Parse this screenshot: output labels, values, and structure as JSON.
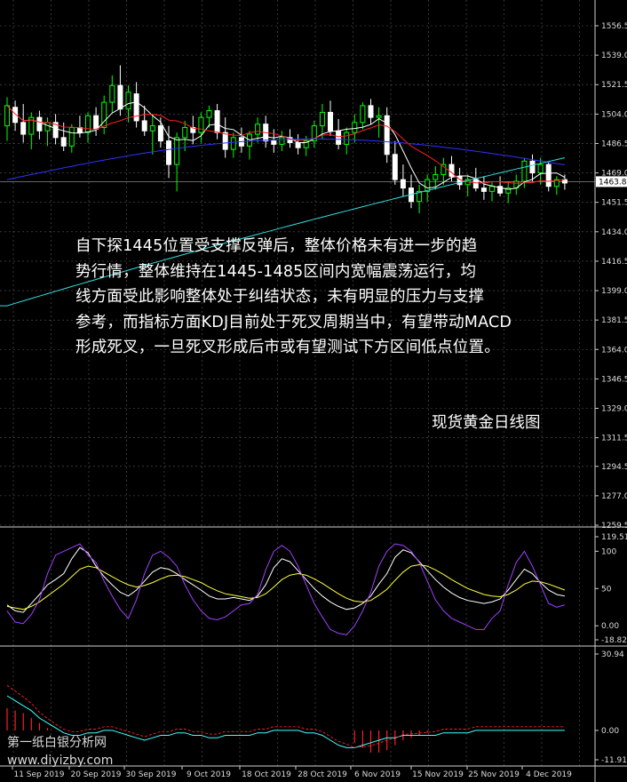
{
  "annotation": {
    "line1": "自下探1445位置受支撑反弹后，整体价格未有进一步的趋",
    "line2": "势行情，整体维持在1445-1485区间内宽幅震荡运行，均",
    "line3": "线方面受此影响整体处于纠结状态，未有明显的压力与支撑",
    "line4": "参考，而指标方面KDJ目前处于死叉周期当中，有望带动MACD",
    "line5": "形成死叉，一旦死叉形成后市或有望测试下方区间低点位置。"
  },
  "caption": "现货黄金日线图",
  "watermark": {
    "line1": "第一纸白银分析网",
    "line2": "www.diyizby.com"
  },
  "colors": {
    "background": "#000000",
    "bull_candle": "#00ff00",
    "bear_candle": "#ffffff",
    "ma_fast": "#ffffff",
    "ma_mid": "#ff2020",
    "ma_slow": "#3030ff",
    "ma_long": "#30e0e0",
    "kdj_k": "#ffffff",
    "kdj_d": "#ffff40",
    "kdj_j": "#a040ff",
    "macd_hist": "#ff2020",
    "macd_signal": "#40ffff"
  },
  "chart_data": [
    {
      "type": "candlestick",
      "panel": "price",
      "y_ticks": [
        "1556.5",
        "1539.0",
        "1521.5",
        "1504.0",
        "1486.5",
        "1469.0",
        "1451.5",
        "1434.0",
        "1416.5",
        "1399.0",
        "1381.5",
        "1364.0",
        "1346.5",
        "1329.0",
        "1311.5",
        "1294.5",
        "1277.0",
        "1259.5"
      ],
      "ylim": [
        1259.5,
        1556.5
      ],
      "current_price": "1463.8",
      "candles": [
        {
          "o": 1497,
          "h": 1514,
          "l": 1488,
          "c": 1509
        },
        {
          "o": 1508,
          "h": 1512,
          "l": 1494,
          "c": 1499
        },
        {
          "o": 1499,
          "h": 1510,
          "l": 1487,
          "c": 1492
        },
        {
          "o": 1492,
          "h": 1505,
          "l": 1483,
          "c": 1502
        },
        {
          "o": 1502,
          "h": 1506,
          "l": 1489,
          "c": 1494
        },
        {
          "o": 1494,
          "h": 1502,
          "l": 1485,
          "c": 1499
        },
        {
          "o": 1499,
          "h": 1504,
          "l": 1486,
          "c": 1490
        },
        {
          "o": 1490,
          "h": 1499,
          "l": 1482,
          "c": 1485
        },
        {
          "o": 1485,
          "h": 1498,
          "l": 1481,
          "c": 1496
        },
        {
          "o": 1496,
          "h": 1503,
          "l": 1490,
          "c": 1493
        },
        {
          "o": 1493,
          "h": 1505,
          "l": 1487,
          "c": 1503
        },
        {
          "o": 1503,
          "h": 1508,
          "l": 1491,
          "c": 1495
        },
        {
          "o": 1496,
          "h": 1515,
          "l": 1492,
          "c": 1511
        },
        {
          "o": 1511,
          "h": 1527,
          "l": 1505,
          "c": 1521
        },
        {
          "o": 1521,
          "h": 1533,
          "l": 1503,
          "c": 1507
        },
        {
          "o": 1507,
          "h": 1521,
          "l": 1499,
          "c": 1517
        },
        {
          "o": 1516,
          "h": 1523,
          "l": 1496,
          "c": 1500
        },
        {
          "o": 1500,
          "h": 1509,
          "l": 1491,
          "c": 1494
        },
        {
          "o": 1494,
          "h": 1504,
          "l": 1480,
          "c": 1497
        },
        {
          "o": 1497,
          "h": 1502,
          "l": 1484,
          "c": 1488
        },
        {
          "o": 1488,
          "h": 1497,
          "l": 1466,
          "c": 1474
        },
        {
          "o": 1474,
          "h": 1493,
          "l": 1458,
          "c": 1490
        },
        {
          "o": 1490,
          "h": 1500,
          "l": 1482,
          "c": 1496
        },
        {
          "o": 1496,
          "h": 1503,
          "l": 1486,
          "c": 1493
        },
        {
          "o": 1493,
          "h": 1505,
          "l": 1487,
          "c": 1502
        },
        {
          "o": 1502,
          "h": 1509,
          "l": 1496,
          "c": 1506
        },
        {
          "o": 1506,
          "h": 1510,
          "l": 1489,
          "c": 1493
        },
        {
          "o": 1493,
          "h": 1502,
          "l": 1478,
          "c": 1483
        },
        {
          "o": 1483,
          "h": 1493,
          "l": 1478,
          "c": 1490
        },
        {
          "o": 1490,
          "h": 1496,
          "l": 1481,
          "c": 1485
        },
        {
          "o": 1485,
          "h": 1494,
          "l": 1477,
          "c": 1492
        },
        {
          "o": 1492,
          "h": 1502,
          "l": 1487,
          "c": 1498
        },
        {
          "o": 1498,
          "h": 1503,
          "l": 1484,
          "c": 1488
        },
        {
          "o": 1488,
          "h": 1495,
          "l": 1481,
          "c": 1486
        },
        {
          "o": 1486,
          "h": 1494,
          "l": 1482,
          "c": 1490
        },
        {
          "o": 1490,
          "h": 1495,
          "l": 1484,
          "c": 1487
        },
        {
          "o": 1487,
          "h": 1492,
          "l": 1480,
          "c": 1484
        },
        {
          "o": 1484,
          "h": 1491,
          "l": 1479,
          "c": 1488
        },
        {
          "o": 1488,
          "h": 1500,
          "l": 1484,
          "c": 1497
        },
        {
          "o": 1497,
          "h": 1510,
          "l": 1489,
          "c": 1505
        },
        {
          "o": 1505,
          "h": 1512,
          "l": 1491,
          "c": 1494
        },
        {
          "o": 1494,
          "h": 1501,
          "l": 1483,
          "c": 1486
        },
        {
          "o": 1486,
          "h": 1496,
          "l": 1480,
          "c": 1493
        },
        {
          "o": 1493,
          "h": 1504,
          "l": 1487,
          "c": 1499
        },
        {
          "o": 1499,
          "h": 1511,
          "l": 1495,
          "c": 1509
        },
        {
          "o": 1509,
          "h": 1513,
          "l": 1498,
          "c": 1502
        },
        {
          "o": 1502,
          "h": 1508,
          "l": 1490,
          "c": 1503
        },
        {
          "o": 1503,
          "h": 1508,
          "l": 1475,
          "c": 1480
        },
        {
          "o": 1480,
          "h": 1488,
          "l": 1462,
          "c": 1465
        },
        {
          "o": 1465,
          "h": 1474,
          "l": 1455,
          "c": 1460
        },
        {
          "o": 1460,
          "h": 1468,
          "l": 1448,
          "c": 1452
        },
        {
          "o": 1452,
          "h": 1462,
          "l": 1445,
          "c": 1458
        },
        {
          "o": 1458,
          "h": 1468,
          "l": 1452,
          "c": 1465
        },
        {
          "o": 1465,
          "h": 1473,
          "l": 1459,
          "c": 1468
        },
        {
          "o": 1468,
          "h": 1478,
          "l": 1462,
          "c": 1474
        },
        {
          "o": 1474,
          "h": 1479,
          "l": 1464,
          "c": 1467
        },
        {
          "o": 1467,
          "h": 1472,
          "l": 1459,
          "c": 1462
        },
        {
          "o": 1462,
          "h": 1468,
          "l": 1455,
          "c": 1465
        },
        {
          "o": 1465,
          "h": 1472,
          "l": 1458,
          "c": 1460
        },
        {
          "o": 1460,
          "h": 1467,
          "l": 1453,
          "c": 1458
        },
        {
          "o": 1458,
          "h": 1464,
          "l": 1452,
          "c": 1461
        },
        {
          "o": 1461,
          "h": 1467,
          "l": 1455,
          "c": 1457
        },
        {
          "o": 1457,
          "h": 1464,
          "l": 1451,
          "c": 1460
        },
        {
          "o": 1460,
          "h": 1468,
          "l": 1456,
          "c": 1464
        },
        {
          "o": 1464,
          "h": 1478,
          "l": 1460,
          "c": 1476
        },
        {
          "o": 1476,
          "h": 1480,
          "l": 1464,
          "c": 1469
        },
        {
          "o": 1469,
          "h": 1478,
          "l": 1462,
          "c": 1474
        },
        {
          "o": 1474,
          "h": 1476,
          "l": 1458,
          "c": 1461
        },
        {
          "o": 1461,
          "h": 1467,
          "l": 1456,
          "c": 1465
        },
        {
          "o": 1465,
          "h": 1468,
          "l": 1459,
          "c": 1463
        }
      ],
      "moving_averages": [
        "ma_fast",
        "ma_mid",
        "ma_slow",
        "ma_long"
      ]
    },
    {
      "type": "line",
      "panel": "kdj",
      "y_ticks": [
        "119.516",
        "100",
        "50",
        "0.00",
        "-18.821"
      ],
      "ylim": [
        -18.821,
        119.516
      ],
      "series": [
        {
          "key": "K",
          "values": [
            28,
            20,
            18,
            30,
            42,
            55,
            62,
            70,
            90,
            105,
            98,
            80,
            66,
            55,
            45,
            40,
            48,
            60,
            72,
            78,
            76,
            70,
            62,
            55,
            48,
            40,
            36,
            36,
            38,
            36,
            34,
            40,
            55,
            78,
            90,
            86,
            74,
            62,
            50,
            40,
            32,
            26,
            22,
            24,
            30,
            40,
            56,
            70,
            92,
            102,
            98,
            86,
            74,
            62,
            52,
            44,
            38,
            34,
            32,
            30,
            32,
            36,
            48,
            62,
            76,
            70,
            58,
            48,
            42,
            40
          ]
        },
        {
          "key": "D",
          "values": [
            26,
            24,
            22,
            26,
            32,
            40,
            48,
            56,
            66,
            76,
            80,
            78,
            72,
            66,
            60,
            55,
            52,
            54,
            58,
            63,
            67,
            68,
            66,
            62,
            58,
            52,
            47,
            43,
            41,
            39,
            37,
            38,
            43,
            52,
            62,
            68,
            70,
            68,
            63,
            57,
            50,
            43,
            37,
            33,
            32,
            34,
            41,
            49,
            61,
            72,
            80,
            82,
            80,
            75,
            69,
            62,
            56,
            50,
            46,
            42,
            40,
            39,
            42,
            48,
            56,
            60,
            59,
            56,
            52,
            48
          ]
        },
        {
          "key": "J",
          "values": [
            20,
            5,
            3,
            15,
            35,
            70,
            95,
            100,
            105,
            110,
            95,
            85,
            60,
            40,
            22,
            10,
            35,
            70,
            95,
            100,
            92,
            80,
            55,
            35,
            20,
            10,
            8,
            12,
            20,
            28,
            30,
            42,
            75,
            100,
            108,
            100,
            80,
            55,
            30,
            12,
            -5,
            -10,
            -12,
            0,
            20,
            45,
            80,
            100,
            110,
            108,
            100,
            85,
            60,
            35,
            20,
            10,
            5,
            0,
            -5,
            -5,
            10,
            20,
            55,
            85,
            100,
            80,
            55,
            30,
            25,
            28
          ]
        }
      ]
    },
    {
      "type": "bar",
      "panel": "macd",
      "y_ticks": [
        "30.94",
        "0.00",
        "-11.91"
      ],
      "ylim": [
        -11.91,
        30.94
      ],
      "series": [
        {
          "key": "histogram",
          "values": [
            9,
            8,
            7,
            5,
            3,
            1,
            0,
            0,
            0,
            0,
            0,
            0,
            0,
            0,
            0,
            0,
            0,
            0,
            0,
            0,
            0,
            0,
            0,
            0,
            0,
            0,
            0,
            0,
            0,
            0,
            0,
            0,
            0,
            0,
            0,
            0,
            0,
            0,
            0,
            0,
            0,
            0,
            0,
            -5,
            -7,
            -9,
            -9,
            -8,
            -6,
            -4,
            -3,
            -2,
            -1,
            0,
            0,
            0,
            0,
            0,
            0,
            0,
            0,
            0,
            0,
            0,
            0,
            0,
            0,
            0,
            0,
            0
          ]
        },
        {
          "key": "signal",
          "values": [
            14,
            12,
            10,
            8,
            5,
            3,
            1,
            -1,
            -2,
            -2,
            -1,
            -1,
            0,
            0,
            -1,
            -2,
            -3,
            -4,
            -3,
            -2,
            -2,
            -1,
            -1,
            -2,
            -2,
            -3,
            -3,
            -2,
            -2,
            -2,
            -2,
            -1,
            -1,
            0,
            0,
            0,
            0,
            -1,
            -1,
            -2,
            -4,
            -6,
            -7,
            -7,
            -6,
            -5,
            -4,
            -3,
            -3,
            -2,
            -2,
            -2,
            -2,
            -2,
            -1,
            -1,
            -1,
            -1,
            0,
            0,
            0,
            0,
            0,
            0,
            0,
            0,
            0,
            0,
            0,
            0
          ]
        }
      ]
    }
  ],
  "x_axis": {
    "ticks": [
      "11 Sep 2019",
      "20 Sep 2019",
      "30 Sep 2019",
      "9 Oct 2019",
      "18 Oct 2019",
      "28 Oct 2019",
      "6 Nov 2019",
      "15 Nov 2019",
      "25 Nov 2019",
      "4 Dec 2019"
    ]
  }
}
